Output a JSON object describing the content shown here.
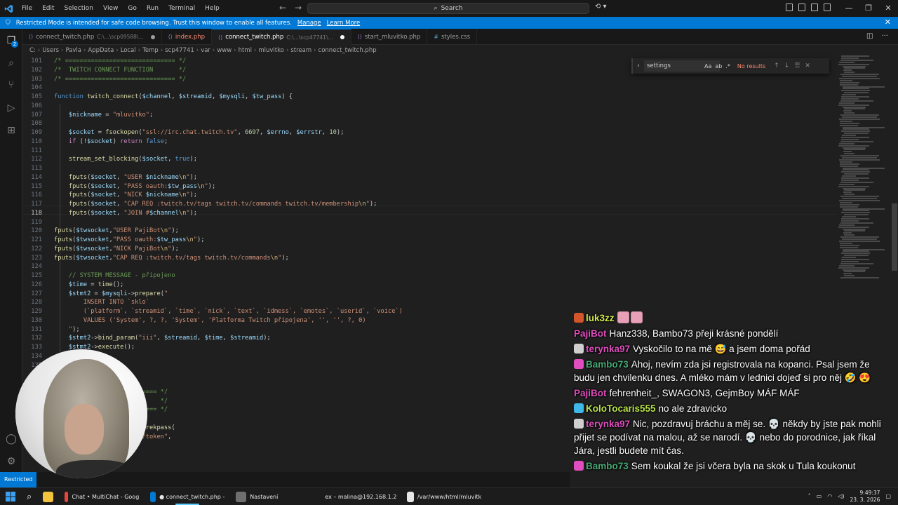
{
  "titlebar": {
    "menu": [
      "File",
      "Edit",
      "Selection",
      "View",
      "Go",
      "Run",
      "Terminal",
      "Help"
    ],
    "search_label": "Search",
    "window_controls": [
      "—",
      "❐",
      "✕"
    ]
  },
  "banner": {
    "message": "Restricted Mode is intended for safe code browsing. Trust this window to enable all features.",
    "manage": "Manage",
    "learn_more": "Learn More"
  },
  "tabs": [
    {
      "name": "connect_twitch.php",
      "sub": "C:\\...\\scp09588\\...",
      "modified": true,
      "active": false,
      "kind": "php"
    },
    {
      "name": "index.php",
      "sub": "",
      "modified": false,
      "active": false,
      "kind": "php",
      "error": true
    },
    {
      "name": "connect_twitch.php",
      "sub": "C:\\...\\scp47741\\...",
      "modified": true,
      "active": true,
      "kind": "php"
    },
    {
      "name": "start_mluvitko.php",
      "sub": "",
      "modified": false,
      "active": false,
      "kind": "php"
    },
    {
      "name": "styles.css",
      "sub": "",
      "modified": false,
      "active": false,
      "kind": "css"
    }
  ],
  "breadcrumb": [
    "C:",
    "Users",
    "Pavla",
    "AppData",
    "Local",
    "Temp",
    "scp47741",
    "var",
    "www",
    "html",
    "mluvitko",
    "stream",
    "connect_twitch.php"
  ],
  "find": {
    "query": "settings",
    "no_results": "No results",
    "options": [
      "Aa",
      "ab",
      ".*"
    ]
  },
  "editor": {
    "current_line": "118",
    "lines": [
      {
        "n": "101",
        "html": "<span class='cm'>/* ============================== */</span>"
      },
      {
        "n": "102",
        "html": "<span class='cm'>/*  TWITCH CONNECT FUNCTION       */</span>"
      },
      {
        "n": "103",
        "html": "<span class='cm'>/* ============================== */</span>"
      },
      {
        "n": "104",
        "html": ""
      },
      {
        "n": "105",
        "html": "<span class='kw'>function</span> <span class='fn'>twitch_connect</span>(<span class='var'>$channel</span>, <span class='var'>$streamid</span>, <span class='var'>$mysqli</span>, <span class='var'>$tw_pass</span>) {"
      },
      {
        "n": "106",
        "html": ""
      },
      {
        "n": "107",
        "html": "    <span class='var'>$nickname</span> = <span class='str'>\"mluvitko\"</span>;"
      },
      {
        "n": "108",
        "html": ""
      },
      {
        "n": "109",
        "html": "    <span class='var'>$socket</span> = <span class='fn'>fsockopen</span>(<span class='str'>\"ssl://irc.chat.twitch.tv\"</span>, <span class='num'>6697</span>, <span class='var'>$errno</span>, <span class='var'>$errstr</span>, <span class='num'>10</span>);"
      },
      {
        "n": "110",
        "html": "    <span class='ctl'>if</span> (!<span class='var'>$socket</span>) <span class='ctl'>return</span> <span class='kw'>false</span>;"
      },
      {
        "n": "111",
        "html": ""
      },
      {
        "n": "112",
        "html": "    <span class='fn'>stream_set_blocking</span>(<span class='var'>$socket</span>, <span class='kw'>true</span>);"
      },
      {
        "n": "113",
        "html": ""
      },
      {
        "n": "114",
        "html": "    <span class='fn'>fputs</span>(<span class='var'>$socket</span>, <span class='str'>\"USER </span><span class='var'>$nickname</span><span class='esc'>\\n</span><span class='str'>\"</span>);"
      },
      {
        "n": "115",
        "html": "    <span class='fn'>fputs</span>(<span class='var'>$socket</span>, <span class='str'>\"PASS oauth:</span><span class='var'>$tw_pass</span><span class='esc'>\\n</span><span class='str'>\"</span>);"
      },
      {
        "n": "116",
        "html": "    <span class='fn'>fputs</span>(<span class='var'>$socket</span>, <span class='str'>\"NICK </span><span class='var'>$nickname</span><span class='esc'>\\n</span><span class='str'>\"</span>);"
      },
      {
        "n": "117",
        "html": "    <span class='fn'>fputs</span>(<span class='var'>$socket</span>, <span class='str'>\"CAP REQ :twitch.tv/tags twitch.tv/commands twitch.tv/membership</span><span class='esc'>\\n</span><span class='str'>\"</span>);"
      },
      {
        "n": "118",
        "html": "    <span class='fn'>fputs</span>(<span class='var'>$socket</span>, <span class='str'>\"JOIN #</span><span class='var'>$channel</span><span class='esc'>\\n</span><span class='str'>\"</span>);"
      },
      {
        "n": "119",
        "html": ""
      },
      {
        "n": "120",
        "html": "<span class='fn'>fputs</span>(<span class='var'>$twsocket</span>,<span class='str'>\"USER PajiBot</span><span class='esc'>\\n</span><span class='str'>\"</span>);"
      },
      {
        "n": "121",
        "html": "<span class='fn'>fputs</span>(<span class='var'>$twsocket</span>,<span class='str'>\"PASS oauth:</span><span class='var'>$tw_pass</span><span class='esc'>\\n</span><span class='str'>\"</span>);"
      },
      {
        "n": "122",
        "html": "<span class='fn'>fputs</span>(<span class='var'>$twsocket</span>,<span class='str'>\"NICK PajiBot</span><span class='esc'>\\n</span><span class='str'>\"</span>);"
      },
      {
        "n": "123",
        "html": "<span class='fn'>fputs</span>(<span class='var'>$twsocket</span>,<span class='str'>\"CAP REQ :twitch.tv/tags twitch.tv/commands</span><span class='esc'>\\n</span><span class='str'>\"</span>);"
      },
      {
        "n": "124",
        "html": ""
      },
      {
        "n": "125",
        "html": "    <span class='cm'>// SYSTEM MESSAGE - připojeno</span>"
      },
      {
        "n": "126",
        "html": "    <span class='var'>$time</span> = <span class='fn'>time</span>();"
      },
      {
        "n": "127",
        "html": "    <span class='var'>$stmt2</span> = <span class='var'>$mysqli</span>-><span class='fn'>prepare</span>(<span class='str'>\"</span>"
      },
      {
        "n": "128",
        "html": "<span class='str'>        INSERT INTO `sklo`</span>"
      },
      {
        "n": "129",
        "html": "<span class='str'>        (`platform`, `streamid`, `time`, `nick`, `text`, `idmess`, `emotes`, `userid`, `voice`)</span>"
      },
      {
        "n": "130",
        "html": "<span class='str'>        VALUES ('System', ?, ?, 'System', 'Platforma Twitch připojena', '', '', ?, 0)</span>"
      },
      {
        "n": "131",
        "html": "<span class='str'>    \"</span>);"
      },
      {
        "n": "132",
        "html": "    <span class='var'>$stmt2</span>-><span class='fn'>bind_param</span>(<span class='str'>\"iii\"</span>, <span class='var'>$streamid</span>, <span class='var'>$time</span>, <span class='var'>$streamid</span>);"
      },
      {
        "n": "133",
        "html": "    <span class='var'>$stmt2</span>-><span class='fn'>execute</span>();"
      },
      {
        "n": "134",
        "html": ""
      },
      {
        "n": "135",
        "html": ""
      },
      {
        "n": "136",
        "html": ""
      },
      {
        "n": "137",
        "html": ""
      },
      {
        "n": "138",
        "html": "<span class='cm'>                 =========== */</span>"
      },
      {
        "n": "139",
        "html": "<span class='cm'>                             */</span>"
      },
      {
        "n": "140",
        "html": "<span class='cm'>                 =========== */</span>"
      },
      {
        "n": "141",
        "html": ""
      },
      {
        "n": "142",
        "html": "                 <span class='fn'>generatorekpass</span>("
      },
      {
        "n": "143",
        "html": "                 <span class='str'>/oauth2/token\"</span>,"
      }
    ]
  },
  "chat": [
    {
      "user": "luk3zz",
      "cls": "u-yellow",
      "badge": "#d4542c",
      "emotes": 2,
      "text": ""
    },
    {
      "user": "PajiBot",
      "cls": "u-pink",
      "badge": "",
      "text": "Hanz338, Bambo73 přeji krásné pondělí"
    },
    {
      "user": "terynka97",
      "cls": "u-magenta",
      "badge": "#cfcfcf",
      "text": "Vyskočilo to na mě 😅 a jsem doma pořád"
    },
    {
      "user": "Bambo73",
      "cls": "u-green",
      "badge": "#e04dbe",
      "text": "Ahoj, nevím zda jsi registrovala na kopanci. Psal jsem že budu jen chvilenku dnes. A mléko mám v lednici dojeď si pro něj 🤣 😍"
    },
    {
      "user": "PajiBot",
      "cls": "u-pink",
      "badge": "",
      "text": "fehrenheit_, SWAGON3, GejmBoy MÁF MÁF"
    },
    {
      "user": "KoloTocaris555",
      "cls": "u-lime",
      "badge": "#3fb8e8",
      "text": "no ale zdravicko"
    },
    {
      "user": "terynka97",
      "cls": "u-magenta",
      "badge": "#cfcfcf",
      "text": "Nic, pozdravuj bráchu a měj se. 💀 někdy by jste pak mohli přijet se podívat na malou, až se narodí. 💀 nebo do porodnice, jak říkal Jára, jestli budete mít čas."
    },
    {
      "user": "Bambo73",
      "cls": "u-green",
      "badge": "#e04dbe",
      "text": "Sem koukal že jsi včera byla na skok u Tula koukonut"
    }
  ],
  "statusbar": {
    "restricted": "Restricted"
  },
  "taskbar": {
    "items": [
      {
        "label": "Chat • MultiChat - Goog",
        "icon": "chrome-icon",
        "color": "#e8453c"
      },
      {
        "label": "● connect_twitch.php -",
        "icon": "vscode-icon",
        "color": "#0078d4"
      },
      {
        "label": "Nastavení",
        "icon": "settings-icon",
        "color": "#6f6f6f"
      },
      {
        "label": "ex – malina@192.168.1.2",
        "icon": "terminal-icon",
        "color": "#2b6fbf"
      },
      {
        "label": "/var/www/html/mluvitk",
        "icon": "editor-icon",
        "color": "#e6e6e6"
      }
    ],
    "time": "9:49:37",
    "date": "23. 3. 2026"
  }
}
